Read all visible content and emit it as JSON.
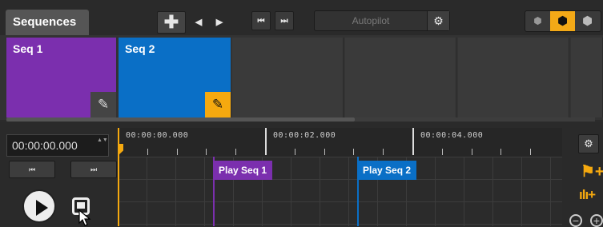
{
  "header": {
    "tab_label": "Sequences",
    "autopilot_label": "Autopilot",
    "icons": {
      "add": "✚",
      "prev": "◀",
      "next": "▶",
      "first": "⏮",
      "last": "⏭",
      "gear": "⚙",
      "view_small": "⬢",
      "view_medium": "⬢",
      "view_large": "⬢"
    }
  },
  "sequences": [
    {
      "name": "Seq 1",
      "color": "#7b2fae",
      "edit_icon": "✎"
    },
    {
      "name": "Seq 2",
      "color": "#0a6fc6",
      "edit_icon": "✎"
    }
  ],
  "timeline": {
    "time_value": "00:00:00.000",
    "spin_icon": "▲▼",
    "first_icon": "⏮",
    "last_icon": "⏭",
    "ruler_labels": [
      "00:00:00.000",
      "00:00:02.000",
      "00:00:04.000"
    ],
    "markers": [
      {
        "label": "Play Seq 1",
        "color": "#7b2fae"
      },
      {
        "label": "Play Seq 2",
        "color": "#0a6fc6"
      }
    ]
  },
  "tools": {
    "gear_icon": "⚙",
    "flag_add_icon": "⚑+",
    "audio_add_icon": "ılı+",
    "zoom_out_icon": "−",
    "zoom_in_icon": "+"
  },
  "colors": {
    "accent": "#f5a90f"
  }
}
